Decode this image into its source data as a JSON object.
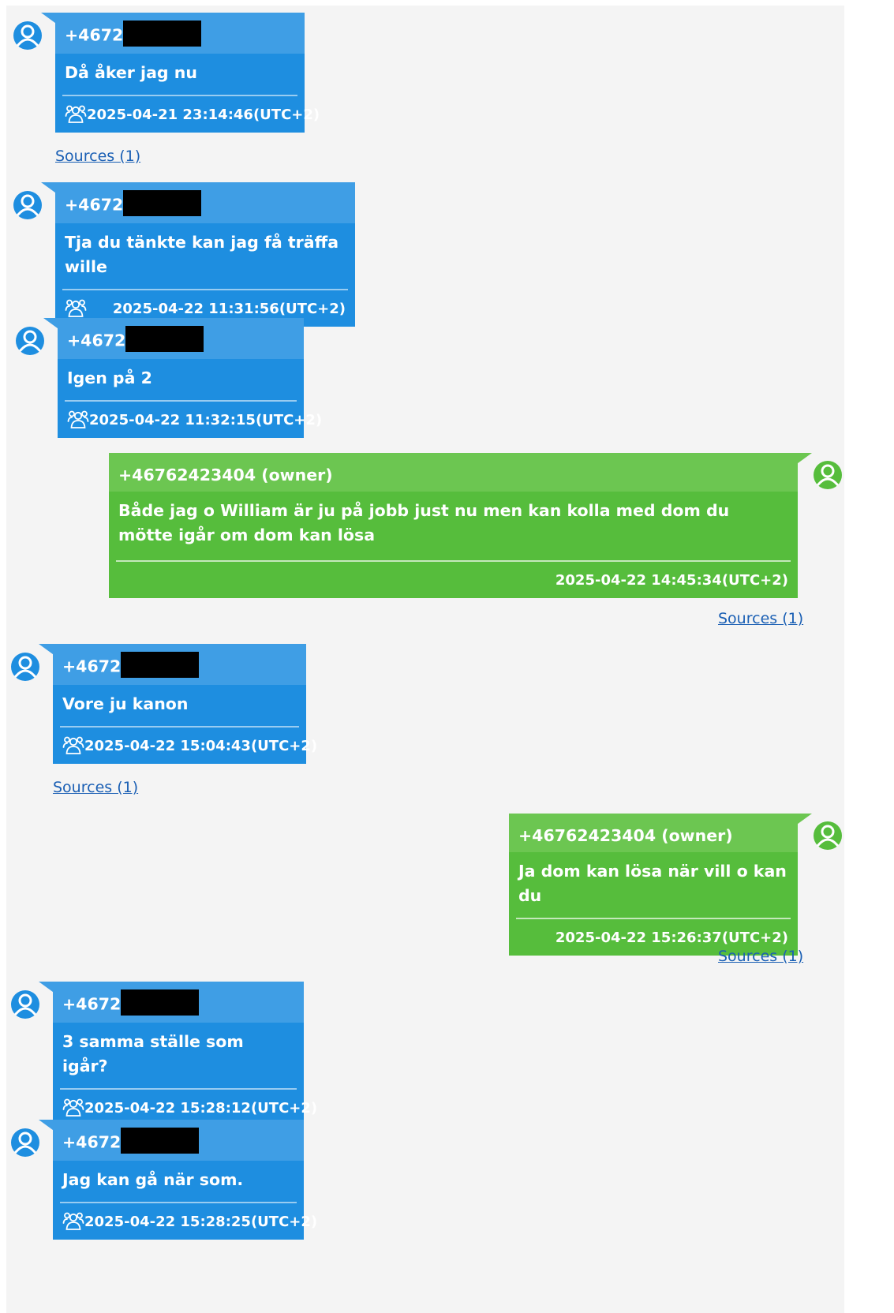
{
  "colors": {
    "incoming_header": "#3f9ee5",
    "incoming_body": "#1e8ee0",
    "outgoing_header": "#6cc651",
    "outgoing_body": "#56bd3c",
    "link": "#1a5fb4",
    "background": "#f4f4f4"
  },
  "icons": {
    "avatar": "user-circle-icon",
    "group": "group-people-icon"
  },
  "messages": [
    {
      "direction": "incoming",
      "sender": "+4672",
      "sender_redacted": true,
      "text": "Då åker jag nu",
      "timestamp": "2025-04-21 23:14:46(UTC+2)",
      "sources": "Sources (1)"
    },
    {
      "direction": "incoming",
      "sender": "+4672",
      "sender_redacted": true,
      "text": "Tja du tänkte kan jag få träffa wille",
      "timestamp": "2025-04-22 11:31:56(UTC+2)"
    },
    {
      "direction": "incoming",
      "sender": "+4672",
      "sender_redacted": true,
      "text": "Igen på 2",
      "timestamp": "2025-04-22 11:32:15(UTC+2)"
    },
    {
      "direction": "outgoing",
      "sender": "+46762423404 (owner)",
      "text": "Både jag o William är ju på jobb just nu men kan kolla med dom du mötte igår om dom kan lösa",
      "timestamp": "2025-04-22 14:45:34(UTC+2)",
      "sources": "Sources (1)"
    },
    {
      "direction": "incoming",
      "sender": "+4672",
      "sender_redacted": true,
      "text": "Vore ju kanon",
      "timestamp": "2025-04-22 15:04:43(UTC+2)",
      "sources": "Sources (1)"
    },
    {
      "direction": "outgoing",
      "sender": "+46762423404 (owner)",
      "text": "Ja dom kan lösa när vill o kan du",
      "timestamp": "2025-04-22 15:26:37(UTC+2)",
      "sources": "Sources (1)"
    },
    {
      "direction": "incoming",
      "sender": "+4672",
      "sender_redacted": true,
      "text": "3 samma ställe som igår?",
      "timestamp": "2025-04-22 15:28:12(UTC+2)"
    },
    {
      "direction": "incoming",
      "sender": "+4672",
      "sender_redacted": true,
      "text": "Jag kan gå när som.",
      "timestamp": "2025-04-22 15:28:25(UTC+2)"
    }
  ]
}
